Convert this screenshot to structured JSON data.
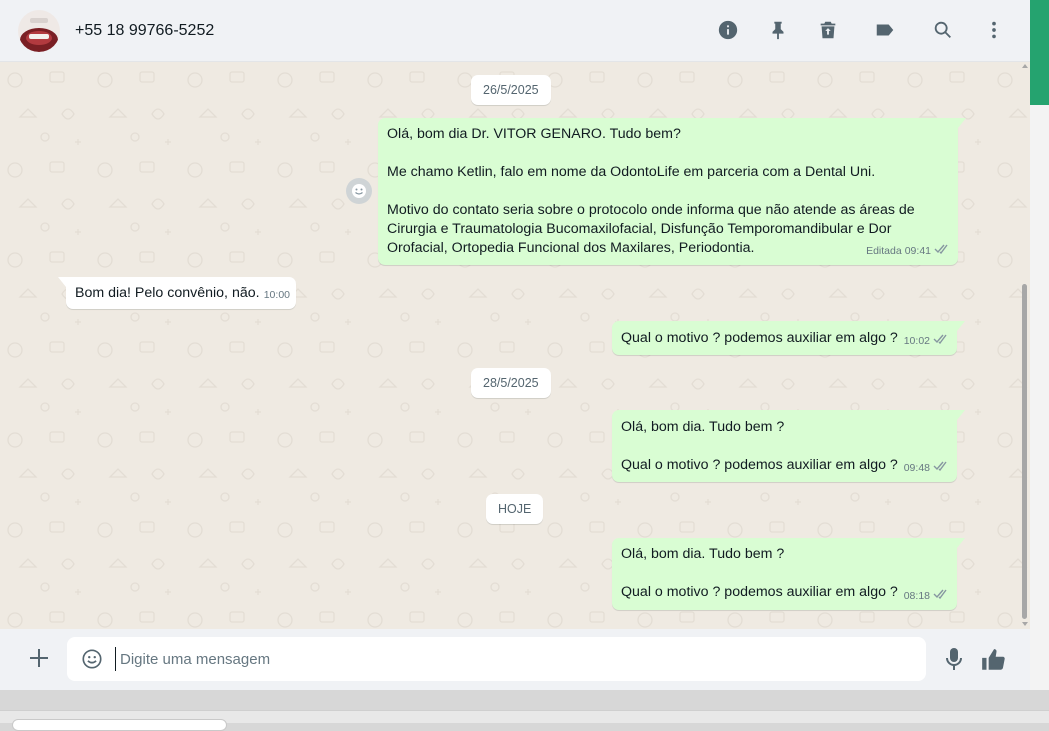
{
  "header": {
    "contact_name": "+55 18 99766-5252",
    "icons": [
      "info-icon",
      "pin-icon",
      "archive-icon",
      "label-icon",
      "search-icon",
      "menu-dots-icon"
    ]
  },
  "chat": {
    "date_chips": [
      "26/5/2025",
      "28/5/2025",
      "HOJE"
    ],
    "messages": [
      {
        "direction": "out",
        "text": "Olá, bom dia Dr. VITOR GENARO. Tudo bem?\n\nMe chamo Ketlin, falo em nome da OdontoLife em parceria com a Dental Uni.\n\nMotivo do contato seria sobre o protocolo onde informa que não atende as áreas de\nCirurgia e Traumatologia Bucomaxilofacial, Disfunção Temporomandibular e Dor\nOrofacial, Ortopedia Funcional dos Maxilares, Periodontia.",
        "edited_label": "Editada",
        "time": "09:41",
        "status": "read"
      },
      {
        "direction": "in",
        "text": "Bom dia! Pelo convênio, não.",
        "time": "10:00"
      },
      {
        "direction": "out",
        "text": "Qual o motivo ? podemos auxiliar em algo ?",
        "time": "10:02",
        "status": "read"
      },
      {
        "direction": "out",
        "text": "Olá, bom dia. Tudo bem ?\n\nQual o motivo ? podemos auxiliar em algo ?",
        "time": "09:48",
        "status": "read"
      },
      {
        "direction": "out",
        "text": "Olá, bom dia. Tudo bem ?\n\nQual o motivo ? podemos auxiliar em algo ?",
        "time": "08:18",
        "status": "read"
      }
    ]
  },
  "composer": {
    "placeholder": "Digite uma mensagem",
    "value": ""
  },
  "colors": {
    "outgoing_bubble": "#d9fdd3",
    "incoming_bubble": "#ffffff",
    "chat_bg": "#efeae2",
    "header_bg": "#f0f2f5",
    "accent_green": "#25a36f",
    "icon_gray": "#54656f"
  }
}
